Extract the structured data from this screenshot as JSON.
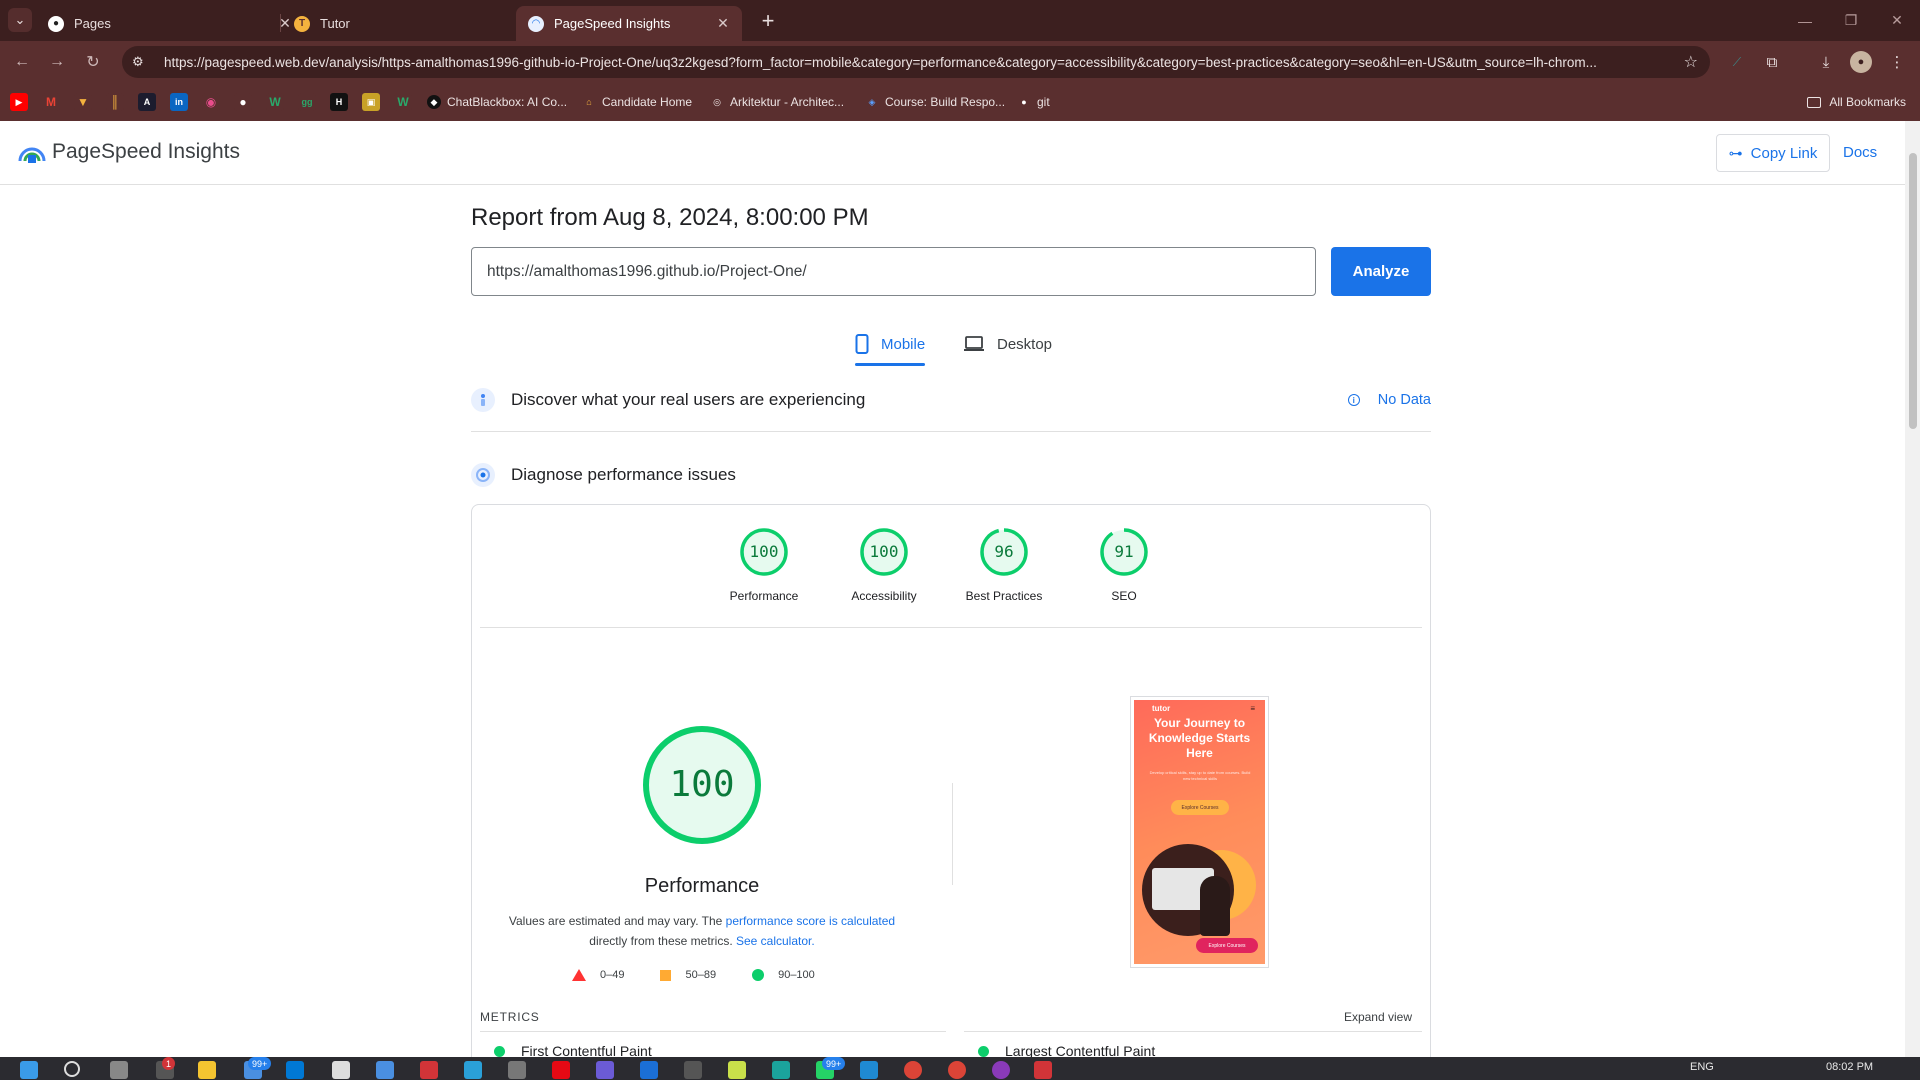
{
  "browser": {
    "tabs": [
      {
        "title": "Pages",
        "favicon": "github-icon",
        "active": false
      },
      {
        "title": "Tutor",
        "favicon": "tutor-favicon",
        "active": false
      },
      {
        "title": "PageSpeed Insights",
        "favicon": "pagespeed-icon",
        "active": true
      }
    ],
    "url": "https://pagespeed.web.dev/analysis/https-amalthomas1996-github-io-Project-One/uq3z2kgesd?form_factor=mobile&category=performance&category=accessibility&category=best-practices&category=seo&hl=en-US&utm_source=lh-chrom...",
    "bookmarks": [
      {
        "label": "ChatBlackbox: AI Co..."
      },
      {
        "label": "Candidate Home"
      },
      {
        "label": "Arkitektur - Architec..."
      },
      {
        "label": "Course: Build Respo..."
      },
      {
        "label": "git"
      }
    ],
    "all_bookmarks": "All Bookmarks"
  },
  "header": {
    "brand": "PageSpeed Insights",
    "copy_link": "Copy Link",
    "docs": "Docs"
  },
  "report": {
    "title": "Report from Aug 8, 2024, 8:00:00 PM",
    "url_value": "https://amalthomas1996.github.io/Project-One/",
    "analyze": "Analyze",
    "device_tabs": {
      "mobile": "Mobile",
      "desktop": "Desktop"
    },
    "discover": "Discover what your real users are experiencing",
    "no_data": "No Data",
    "diagnose": "Diagnose performance issues"
  },
  "scores": [
    {
      "label": "Performance",
      "value": "100"
    },
    {
      "label": "Accessibility",
      "value": "100"
    },
    {
      "label": "Best Practices",
      "value": "96"
    },
    {
      "label": "SEO",
      "value": "91"
    }
  ],
  "performance": {
    "score": "100",
    "title": "Performance",
    "note_prefix": "Values are estimated and may vary. The ",
    "note_link1": "performance score is calculated",
    "note_mid": "directly from these metrics. ",
    "note_link2": "See calculator.",
    "legend": {
      "fail": "0–49",
      "average": "50–89",
      "pass": "90–100"
    },
    "colors": {
      "pass": "#0cce6b",
      "average": "#ffaa33",
      "fail": "#ff3333",
      "accent": "#1a73e8"
    }
  },
  "thumbnail": {
    "logo": "tutor",
    "headline": "Your Journey to Knowledge Starts Here",
    "paragraph": "Develop critical skills, stay up to date from courses. Build new technical skills",
    "button1": "Explore Courses",
    "button2": "Explore Courses"
  },
  "metrics": {
    "label": "METRICS",
    "expand": "Expand view",
    "items": [
      "First Contentful Paint",
      "Largest Contentful Paint"
    ]
  },
  "taskbar": {
    "badges": [
      "1",
      "99+",
      "99+"
    ],
    "lang": "ENG",
    "time": "08:02 PM"
  }
}
